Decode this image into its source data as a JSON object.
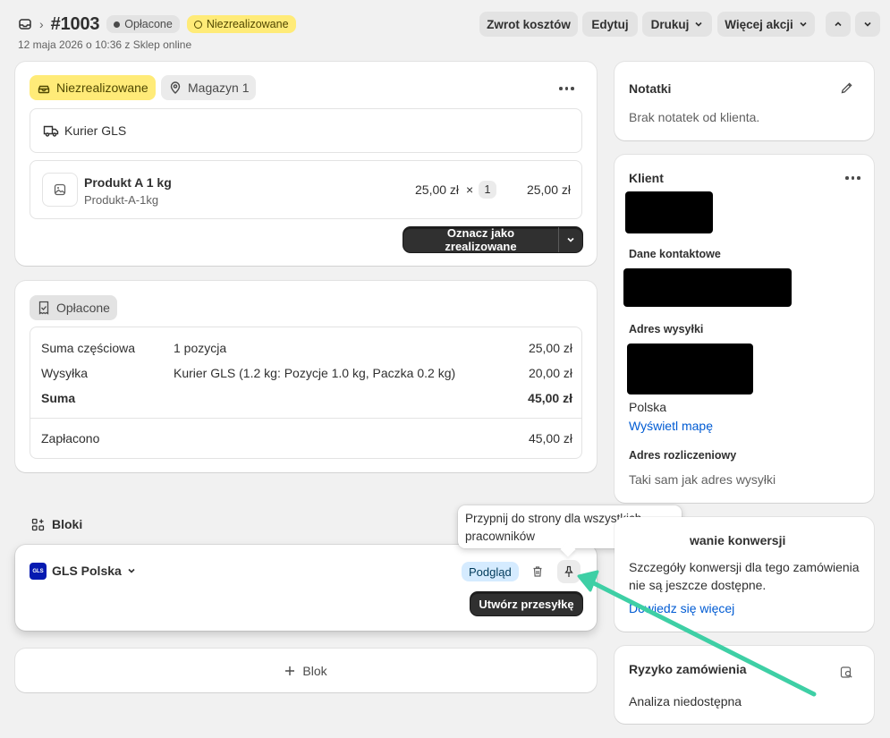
{
  "header": {
    "order_number": "#1003",
    "payment_badge": "Opłacone",
    "fulfillment_badge": "Niezrealizowane",
    "subline": "12 maja 2026 o 10:36 z Sklep online",
    "buttons": {
      "refund": "Zwrot kosztów",
      "edit": "Edytuj",
      "print": "Drukuj",
      "more": "Więcej akcji"
    }
  },
  "fulfillment_card": {
    "status_tag": "Niezrealizowane",
    "location_tag": "Magazyn 1",
    "shipping_method": "Kurier GLS",
    "product": {
      "name": "Produkt A 1 kg",
      "sku": "Produkt-A-1kg",
      "price": "25,00 zł",
      "times": "×",
      "qty": "1",
      "total": "25,00 zł"
    },
    "mark_fulfilled": "Oznacz jako zrealizowane"
  },
  "payment_card": {
    "status_tag": "Opłacone",
    "rows": [
      {
        "label": "Suma częściowa",
        "detail": "1 pozycja",
        "amount": "25,00 zł"
      },
      {
        "label": "Wysyłka",
        "detail": "Kurier GLS (1.2 kg: Pozycje 1.0 kg, Paczka 0.2 kg)",
        "amount": "20,00 zł"
      },
      {
        "label": "Suma",
        "detail": "",
        "amount": "45,00 zł"
      }
    ],
    "paid_label": "Zapłacono",
    "paid_amount": "45,00 zł"
  },
  "blocks": {
    "title": "Bloki",
    "gls_logo_text": "GLS",
    "app_name": "GLS Polska",
    "preview_badge": "Podgląd",
    "create_shipment": "Utwórz przesyłkę",
    "tooltip": "Przypnij do strony dla wszystkich pracowników",
    "add_block": "Blok"
  },
  "notes": {
    "title": "Notatki",
    "text": "Brak notatek od klienta."
  },
  "customer": {
    "title": "Klient",
    "contact_heading": "Dane kontaktowe",
    "shipping_heading": "Adres wysyłki",
    "country": "Polska",
    "map_link": "Wyświetl mapę",
    "billing_heading": "Adres rozliczeniowy",
    "billing_text": "Taki sam jak adres wysyłki"
  },
  "conversion": {
    "title": "wanie konwersji",
    "text": "Szczegóły konwersji dla tego zamówienia nie są jeszcze dostępne.",
    "link": "Dowiedz się więcej"
  },
  "risk": {
    "title": "Ryzyko zamówienia",
    "text": "Analiza niedostępna"
  },
  "colors": {
    "annotation_arrow": "#3ecfa5",
    "link": "#005bd3",
    "fulfill_yellow": "#ffeb78"
  }
}
